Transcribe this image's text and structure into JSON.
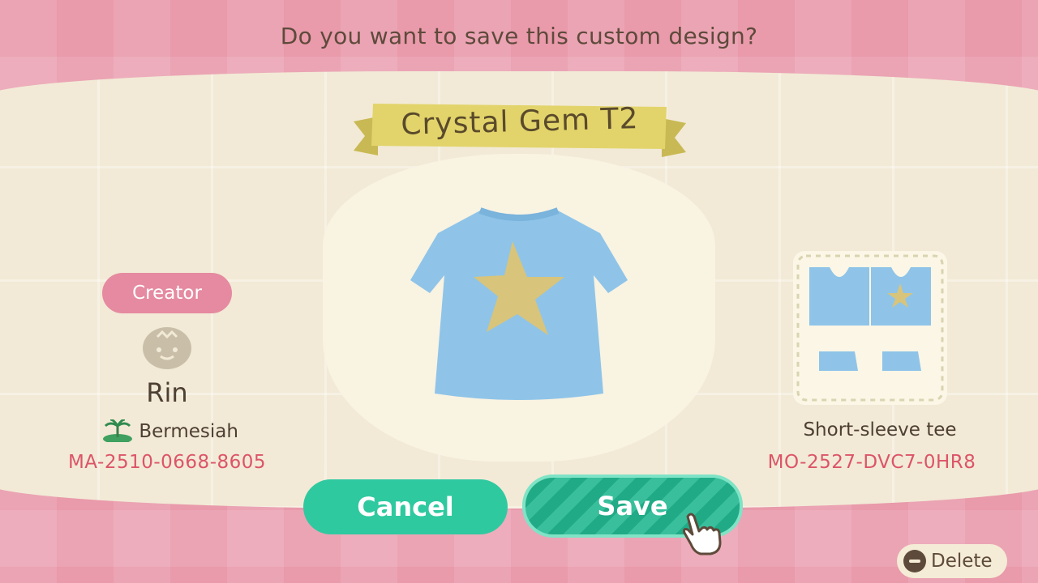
{
  "dialog": {
    "prompt": "Do you want to save this custom design?",
    "design_title": "Crystal Gem T2"
  },
  "creator": {
    "badge_label": "Creator",
    "avatar_icon": "villager-face-icon",
    "name": "Rin",
    "island_icon": "island-palm-icon",
    "island": "Bermesiah",
    "creator_id": "MA-2510-0668-8605"
  },
  "design": {
    "preview_icon": "shirt-with-star-icon",
    "item_type": "Short-sleeve tee",
    "design_id": "MO-2527-DVC7-0HR8",
    "colors": {
      "shirt": "#8fc4e8",
      "star": "#d8c47a"
    }
  },
  "buttons": {
    "cancel": "Cancel",
    "save": "Save"
  },
  "hint": {
    "button_icon": "minus-button-icon",
    "delete": "Delete"
  },
  "colors": {
    "background": "#e99aab",
    "panel": "#f2ead6",
    "accent_teal": "#2fc9a0",
    "id_pink": "#dc5468",
    "ribbon": "#e2d46a"
  }
}
